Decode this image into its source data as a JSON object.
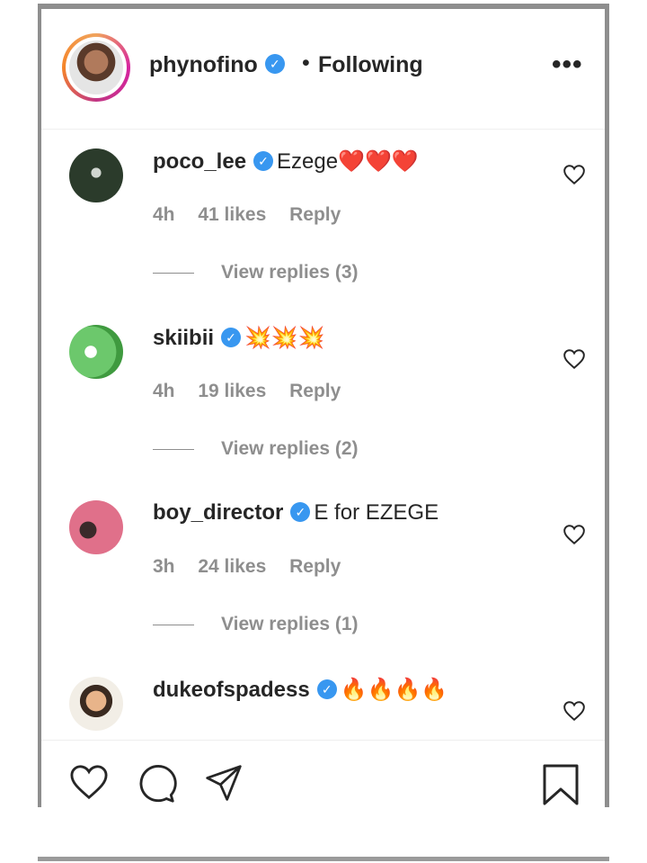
{
  "header": {
    "username": "phynofino",
    "separator": "•",
    "following_label": "Following",
    "more_label": "•••"
  },
  "comments": [
    {
      "username": "poco_lee",
      "text": "Ezege❤️❤️❤️",
      "time": "4h",
      "likes": "41 likes",
      "reply_label": "Reply",
      "view_replies": "View replies (3)",
      "avatar_color": "#2a3a2a"
    },
    {
      "username": "skiibii",
      "text": "💥💥💥",
      "time": "4h",
      "likes": "19 likes",
      "reply_label": "Reply",
      "view_replies": "View replies (2)",
      "avatar_color": "#5cbf5c"
    },
    {
      "username": "boy_director",
      "text": "E for EZEGE",
      "time": "3h",
      "likes": "24 likes",
      "reply_label": "Reply",
      "view_replies": "View replies (1)",
      "avatar_color": "#d9607a"
    },
    {
      "username": "dukeofspadess",
      "text": "🔥🔥🔥🔥",
      "avatar_color": "#c79a6b"
    }
  ],
  "footer": {
    "icons": [
      "heart-icon",
      "comment-icon",
      "share-icon",
      "bookmark-icon"
    ]
  },
  "colors": {
    "verified": "#3897f0",
    "meta_text": "#8e8e8e",
    "frame": "#8e8e8e"
  }
}
